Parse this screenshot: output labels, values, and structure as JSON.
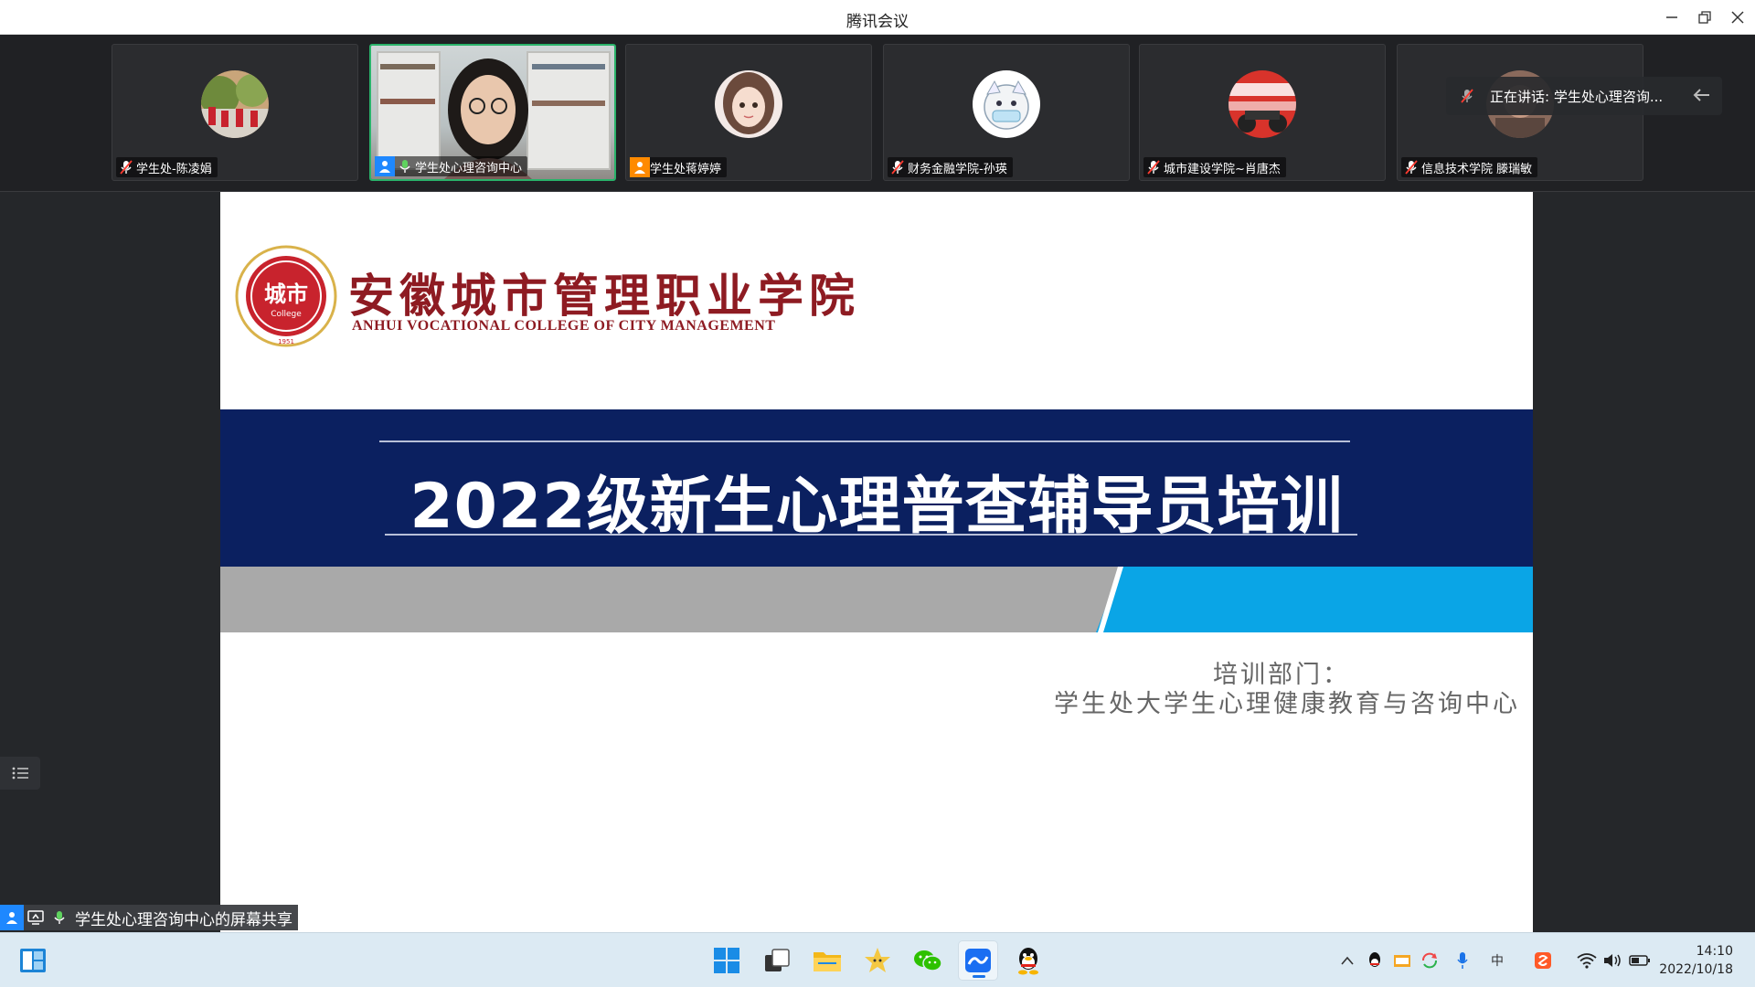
{
  "window": {
    "title": "腾讯会议"
  },
  "participants": [
    {
      "name": "学生处-陈凌娟"
    },
    {
      "name": "学生处心理咨询中心"
    },
    {
      "name": "学生处蒋婷婷"
    },
    {
      "name": "财务金融学院-孙瑛"
    },
    {
      "name": "城市建设学院~肖唐杰"
    },
    {
      "name": "信息技术学院 滕瑞敏"
    }
  ],
  "speaking": {
    "text": "正在讲话: 学生处心理咨询..."
  },
  "slide": {
    "logo_seal_text": "城市",
    "logo_seal_sub": "College",
    "logo_seal_year": "1951",
    "school_cn": "安徽城市管理职业学院",
    "school_en": "ANHUI VOCATIONAL COLLEGE OF CITY MANAGEMENT",
    "headline": "2022级新生心理普查辅导员培训",
    "dept_label": "培训部门：",
    "dept_name": "学生处大学生心理健康教育与咨询中心"
  },
  "share": {
    "text": "学生处心理咨询中心的屏幕共享"
  },
  "taskbar": {
    "time": "14:10",
    "date": "2022/10/18",
    "ime": "中"
  },
  "colors": {
    "banner": "#0b2060",
    "accent_blue": "#0aa5e6",
    "logo_red": "#8e1b22",
    "active_border": "#29b36a"
  }
}
